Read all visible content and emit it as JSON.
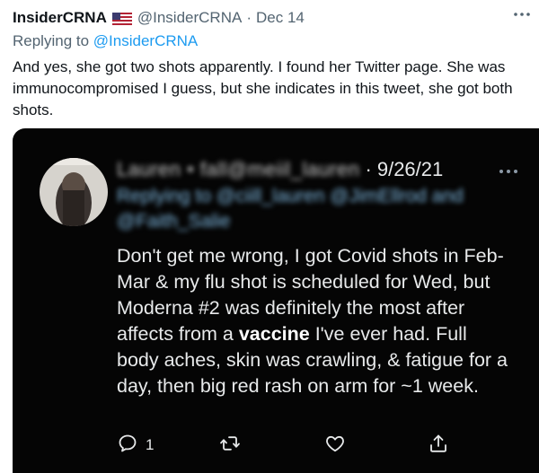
{
  "tweet": {
    "display_name": "InsiderCRNA",
    "flag_icon": "us-flag-icon",
    "handle": "@InsiderCRNA",
    "separator": "·",
    "date": "Dec 14",
    "replying_prefix": "Replying to",
    "replying_mention": "@InsiderCRNA",
    "text": "And yes, she got two shots apparently. I found her Twitter page. She was immunocompromised I guess, but she indicates in this tweet, she got both shots."
  },
  "screenshot": {
    "name_blurred": "Lauren • fall@meiil_lauren",
    "separator": "·",
    "date": "9/26/21",
    "replying_blurred": "Replying to @ciill_lauren @JimEllrod and @Faith_Salie",
    "text_before": "Don't get me wrong, I got Covid shots in Feb-Mar & my flu shot is scheduled for Wed, but Moderna #2 was definitely the most after affects from a ",
    "text_bold": "vaccine",
    "text_after": " I've ever had. Full body aches, skin was crawling, & fatigue for a day, then big red rash on arm for ~1 week.",
    "reply_count": "1",
    "icons": [
      "reply-icon",
      "retweet-icon",
      "like-icon",
      "share-icon"
    ]
  },
  "colors": {
    "link": "#1d9bf0",
    "muted": "#536471",
    "text": "#0f1419",
    "media_bg": "#050505",
    "media_text": "#e7e9ea"
  }
}
